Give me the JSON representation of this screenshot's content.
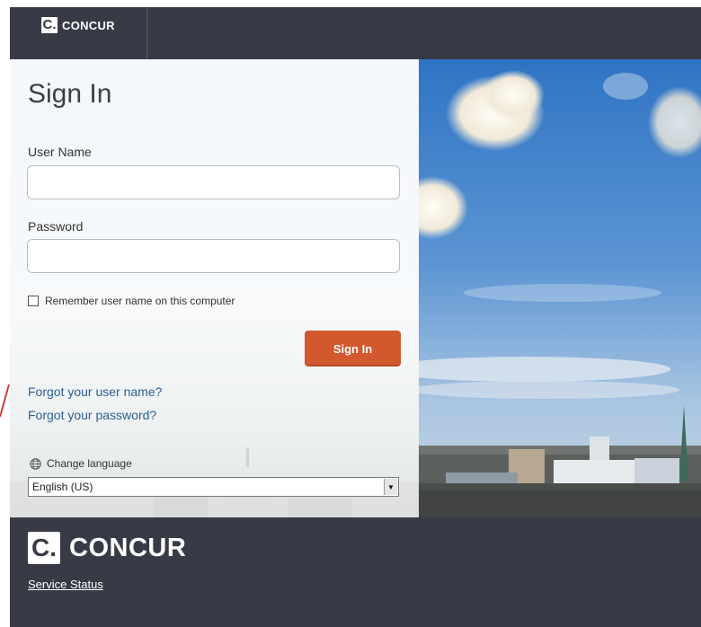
{
  "header": {
    "logo_mark": "C.",
    "logo_text": "CONCUR"
  },
  "signin": {
    "title": "Sign In",
    "username_label": "User Name",
    "username_value": "",
    "password_label": "Password",
    "password_value": "",
    "remember_label": "Remember user name on this computer",
    "remember_checked": false,
    "button_label": "Sign In",
    "forgot_username": "Forgot your user name?",
    "forgot_password": "Forgot your password?",
    "language_label": "Change language",
    "language_selected": "English (US)"
  },
  "footer": {
    "logo_mark": "C.",
    "logo_text": "CONCUR",
    "service_status": "Service Status"
  },
  "colors": {
    "header_bg": "#383b45",
    "button": "#d2582e",
    "link": "#2b5f91"
  },
  "icons": [
    "globe-icon",
    "dropdown-arrow-icon",
    "checkbox-icon"
  ]
}
